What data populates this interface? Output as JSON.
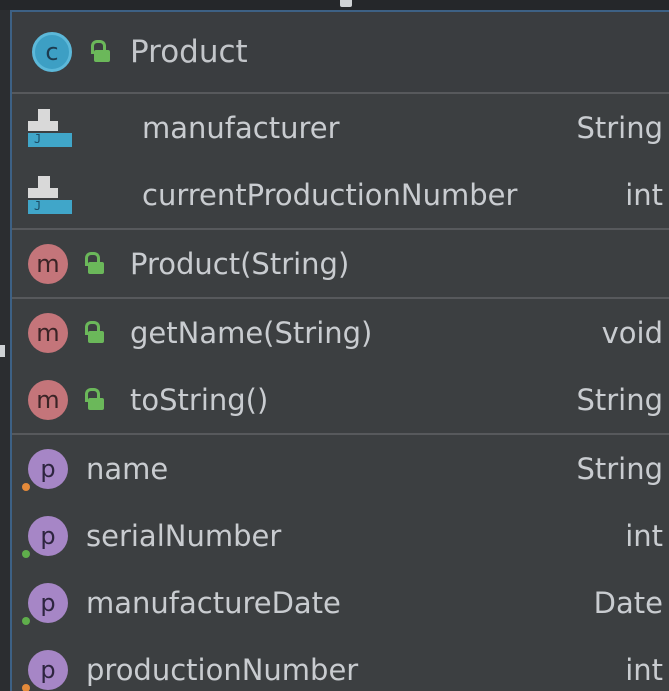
{
  "class": {
    "name": "Product",
    "icon_letter": "c",
    "fields": [
      {
        "name": "manufacturer",
        "type": "String"
      },
      {
        "name": "currentProductionNumber",
        "type": "int"
      }
    ],
    "constructors": [
      {
        "name": "Product(String)",
        "icon_letter": "m"
      }
    ],
    "methods": [
      {
        "name": "getName(String)",
        "type": "void",
        "icon_letter": "m"
      },
      {
        "name": "toString()",
        "type": "String",
        "icon_letter": "m"
      }
    ],
    "properties": [
      {
        "name": "name",
        "type": "String",
        "icon_letter": "p",
        "access_dot": "orange"
      },
      {
        "name": "serialNumber",
        "type": "int",
        "icon_letter": "p",
        "access_dot": "green"
      },
      {
        "name": "manufactureDate",
        "type": "Date",
        "icon_letter": "p",
        "access_dot": "green"
      },
      {
        "name": "productionNumber",
        "type": "int",
        "icon_letter": "p",
        "access_dot": "orange"
      }
    ]
  },
  "colors": {
    "background": "#3c3f41",
    "selection_border": "#3d6185",
    "field_icon": "#40a6c9",
    "method_icon": "#c4757a",
    "property_icon": "#a686c6",
    "public_lock": "#6bb85a"
  }
}
